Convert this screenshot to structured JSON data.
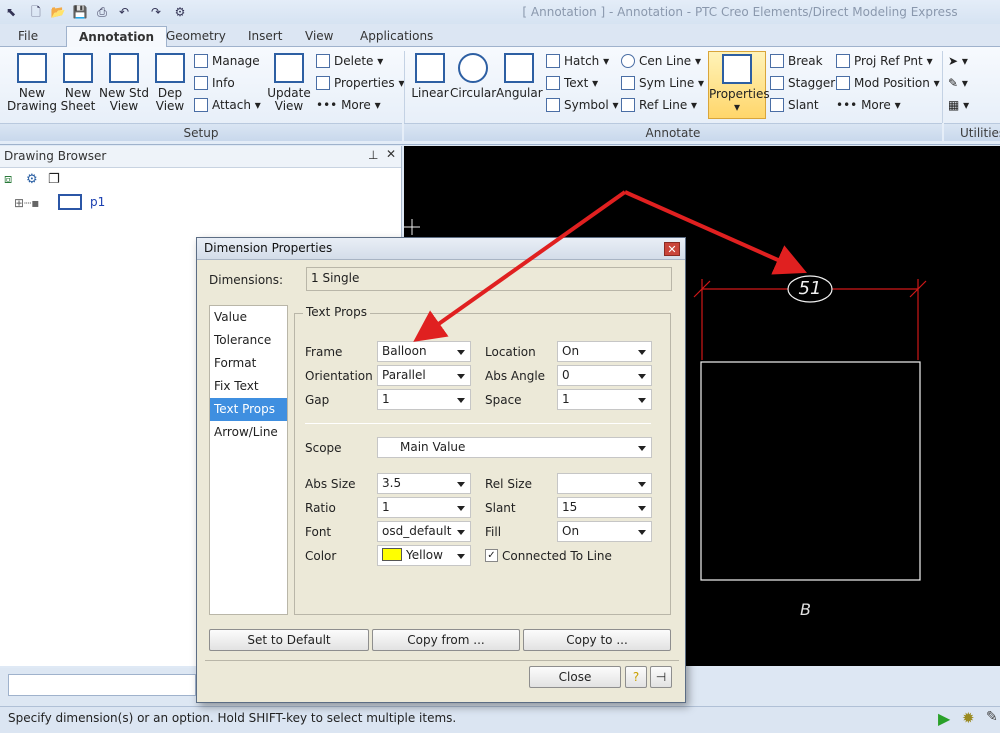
{
  "window": {
    "title": "[ Annotation ] - Annotation - PTC Creo Elements/Direct Modeling Express"
  },
  "tabs": [
    "File",
    "Annotation",
    "Geometry",
    "Insert",
    "View",
    "Applications"
  ],
  "ribbon": {
    "setup": {
      "label": "Setup",
      "new_drawing": "New\nDrawing",
      "new_sheet": "New\nSheet",
      "new_std_view": "New Std\nView",
      "dep_view": "Dep\nView",
      "manage": "Manage",
      "info": "Info",
      "attach": "Attach",
      "update_view": "Update\nView",
      "delete": "Delete",
      "properties": "Properties",
      "more": "More"
    },
    "annotate": {
      "label": "Annotate",
      "linear": "Linear",
      "circular": "Circular",
      "angular": "Angular",
      "hatch": "Hatch",
      "text": "Text",
      "symbol": "Symbol",
      "cen_line": "Cen Line",
      "sym_line": "Sym Line",
      "ref_line": "Ref Line",
      "properties": "Properties",
      "break": "Break",
      "stagger": "Stagger",
      "slant": "Slant",
      "proj_ref_pnt": "Proj Ref Pnt",
      "mod_position": "Mod Position",
      "more": "More"
    },
    "utilities": {
      "label": "Utilities"
    }
  },
  "browser": {
    "title": "Drawing Browser",
    "node": "p1"
  },
  "canvas": {
    "dimension_value": "51",
    "view_label": "B"
  },
  "dialog": {
    "title": "Dimension Properties",
    "dimensions_label": "Dimensions:",
    "dimensions_value": "1 Single",
    "nav": [
      "Value",
      "Tolerance",
      "Format",
      "Fix Text",
      "Text Props",
      "Arrow/Line"
    ],
    "nav_selected": "Text Props",
    "group_title": "Text Props",
    "fields": {
      "frame": {
        "label": "Frame",
        "value": "Balloon"
      },
      "location": {
        "label": "Location",
        "value": "On"
      },
      "orientation": {
        "label": "Orientation",
        "value": "Parallel"
      },
      "abs_angle": {
        "label": "Abs Angle",
        "value": "0"
      },
      "gap": {
        "label": "Gap",
        "value": "1"
      },
      "space": {
        "label": "Space",
        "value": "1"
      },
      "scope": {
        "label": "Scope",
        "value": "Main Value"
      },
      "abs_size": {
        "label": "Abs Size",
        "value": "3.5"
      },
      "rel_size": {
        "label": "Rel Size",
        "value": ""
      },
      "ratio": {
        "label": "Ratio",
        "value": "1"
      },
      "slant": {
        "label": "Slant",
        "value": "15"
      },
      "font": {
        "label": "Font",
        "value": "osd_default"
      },
      "fill": {
        "label": "Fill",
        "value": "On"
      },
      "color": {
        "label": "Color",
        "value": "Yellow",
        "swatch": "#ffff00"
      },
      "connected": {
        "label": "Connected To Line",
        "checked": true
      }
    },
    "buttons": {
      "set_default": "Set to Default",
      "copy_from": "Copy from ...",
      "copy_to": "Copy to ...",
      "close": "Close"
    }
  },
  "status": {
    "text": "Specify dimension(s) or an option. Hold SHIFT-key to select multiple items."
  },
  "colors": {
    "annotation_arrow": "#e02020",
    "dimension_red": "#d01818",
    "selected_nav": "#3f8fe0"
  }
}
